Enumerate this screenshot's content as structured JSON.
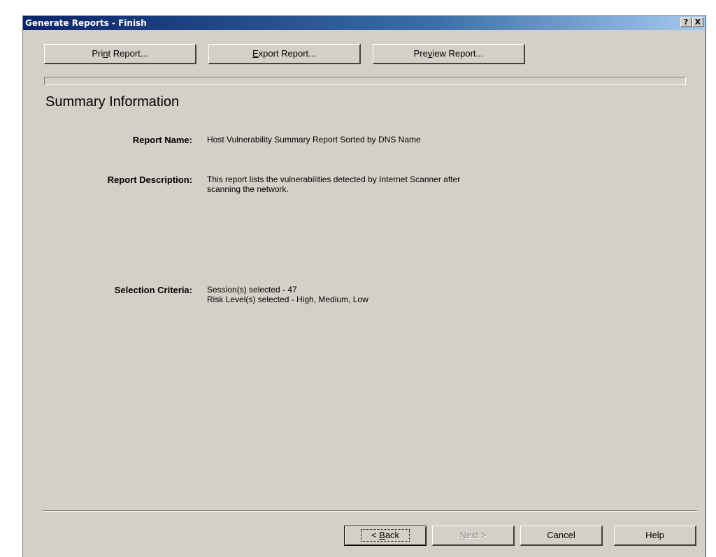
{
  "window": {
    "title": "Generate Reports - Finish",
    "help_button": "?",
    "close_button": "X"
  },
  "toolbar": {
    "print": {
      "pre": "Pri",
      "key": "n",
      "post": "t Report..."
    },
    "export": {
      "pre": "",
      "key": "E",
      "post": "xport Report..."
    },
    "preview": {
      "pre": "Pre",
      "key": "v",
      "post": "iew Report..."
    }
  },
  "progress": {
    "value": 0
  },
  "summary": {
    "heading": "Summary Information",
    "report_name_label": "Report Name:",
    "report_name_value": "Host Vulnerability Summary Report Sorted by DNS Name",
    "description_label": "Report Description:",
    "description_lines": [
      "This report lists the vulnerabilities detected by Internet Scanner after",
      "scanning the network."
    ],
    "criteria_label": "Selection Criteria:",
    "criteria_lines": [
      "Session(s) selected - 47",
      "Risk Level(s) selected - High, Medium, Low"
    ]
  },
  "footer": {
    "back": {
      "pre": "< ",
      "key": "B",
      "post": "ack"
    },
    "next": {
      "pre": "",
      "key": "N",
      "post": "ext >"
    },
    "cancel": "Cancel",
    "help": "Help"
  }
}
